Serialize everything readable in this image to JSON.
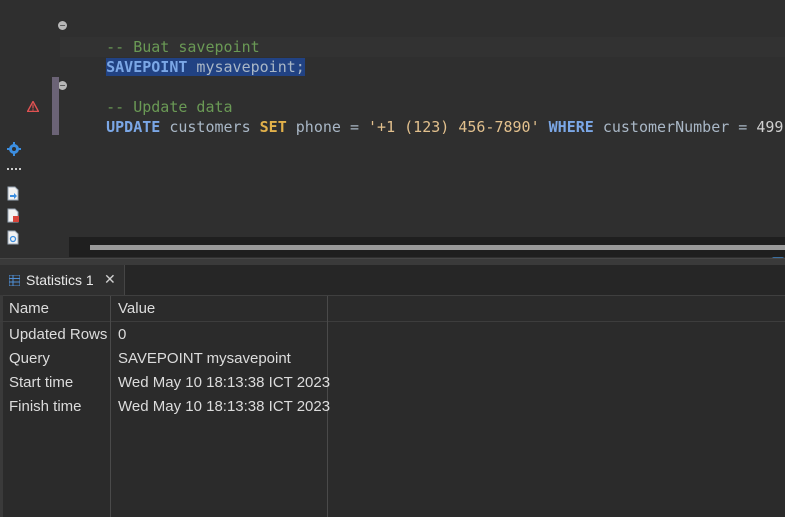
{
  "editor": {
    "lines": [
      {
        "comment": "-- Buat savepoint"
      },
      {
        "kw": "SAVEPOINT",
        "rest": " mysavepoint;"
      },
      {
        "comment": "-- Update data"
      },
      {
        "kw_update": "UPDATE",
        "table": " customers ",
        "kw_set": "SET",
        "col": " phone = ",
        "value": "'+1 (123) 456-7890'",
        "kw_where": " WHERE",
        "cond": " customerNumber = ",
        "num": "499",
        "end": ";"
      }
    ],
    "side_icons": [
      "gear-icon",
      "more-dots-icon",
      "script-icon",
      "script-error-icon",
      "script-document-icon"
    ],
    "warning_icon": "warning-icon"
  },
  "results": {
    "tab": {
      "label": "Statistics 1",
      "icon": "grid-icon",
      "close": "✕"
    },
    "columns": [
      "Name",
      "Value"
    ],
    "rows": [
      {
        "name": "Updated Rows",
        "value": "0"
      },
      {
        "name": "Query",
        "value": "SAVEPOINT mysavepoint"
      },
      {
        "name": "Start time",
        "value": "Wed May 10 18:13:38 ICT 2023"
      },
      {
        "name": "Finish time",
        "value": "Wed May 10 18:13:38 ICT 2023"
      }
    ]
  },
  "colors": {
    "keyword": "#7ba7e6",
    "comment": "#6a9955",
    "string": "#e2c08d",
    "selection": "#214283",
    "background": "#2b2b2b"
  }
}
